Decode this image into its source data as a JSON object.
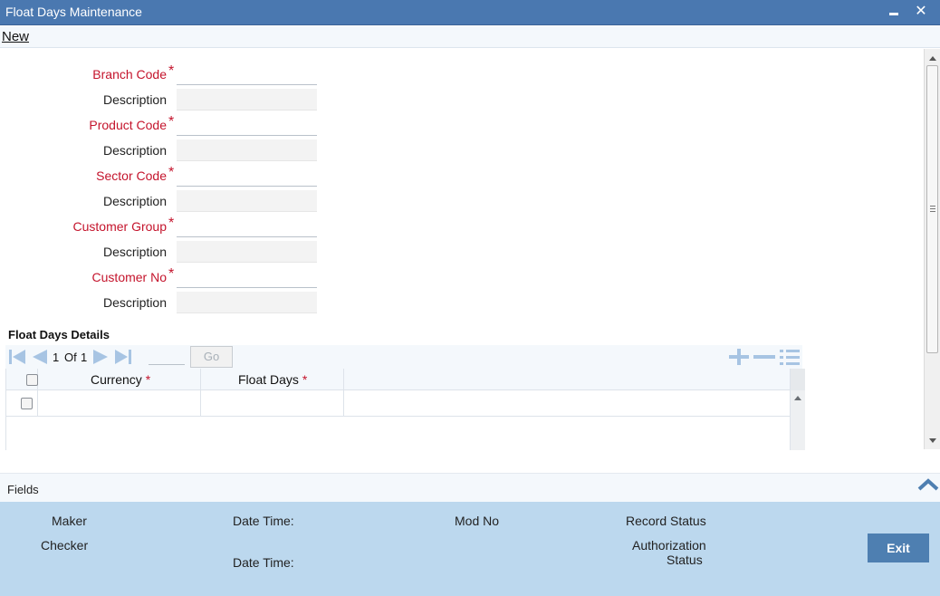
{
  "window": {
    "title": "Float Days Maintenance",
    "minimize_icon": "minimize-icon",
    "close_icon": "close-icon",
    "close_glyph": "✕"
  },
  "menu": {
    "new_label": "New"
  },
  "form": {
    "required_mark": "*",
    "fields": [
      {
        "label": "Branch Code",
        "required": true,
        "value": "",
        "description_label": "Description",
        "description_value": ""
      },
      {
        "label": "Product Code",
        "required": true,
        "value": "",
        "description_label": "Description",
        "description_value": ""
      },
      {
        "label": "Sector Code",
        "required": true,
        "value": "",
        "description_label": "Description",
        "description_value": ""
      },
      {
        "label": "Customer Group",
        "required": true,
        "value": "",
        "description_label": "Description",
        "description_value": ""
      },
      {
        "label": "Customer No",
        "required": true,
        "value": "",
        "description_label": "Description",
        "description_value": ""
      }
    ]
  },
  "details": {
    "title": "Float Days Details",
    "pager": {
      "current": "1",
      "of_label": "Of",
      "total": "1",
      "page_value": ""
    },
    "go_label": "Go",
    "columns": [
      {
        "label": "Currency",
        "required": true
      },
      {
        "label": "Float Days",
        "required": true
      }
    ],
    "rows": [
      {
        "currency": "",
        "float_days": ""
      }
    ]
  },
  "fields_bar": {
    "label": "Fields"
  },
  "audit": {
    "maker_label": "Maker",
    "checker_label": "Checker",
    "maker_datetime_label": "Date Time:",
    "checker_datetime_label": "Date Time:",
    "mod_no_label": "Mod No",
    "record_status_label": "Record Status",
    "authorization_label": "Authorization",
    "status_label": "Status",
    "exit_label": "Exit"
  },
  "colors": {
    "titlebar": "#4a78b0",
    "required": "#c4142c",
    "footer": "#bcd8ee",
    "exit_button": "#4e7fb1",
    "nav_icons": "#a7c4e3"
  }
}
